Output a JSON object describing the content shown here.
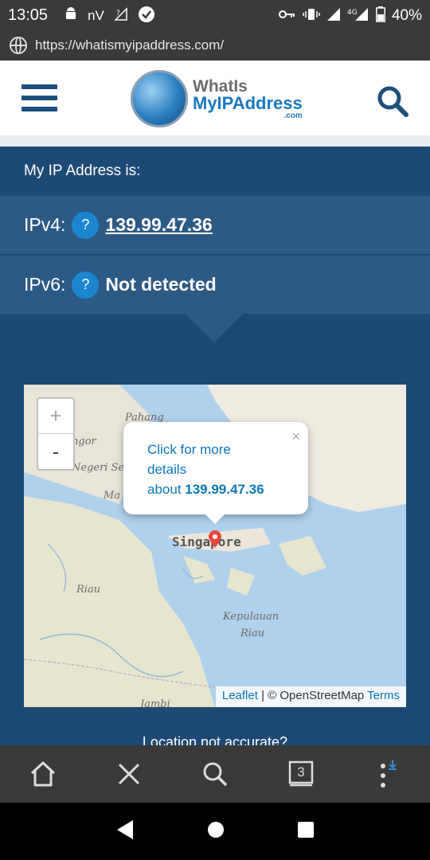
{
  "status_bar": {
    "time": "13:05",
    "carrier": "nV",
    "battery": "40%"
  },
  "url_bar": {
    "url": "https://whatismyipaddress.com/"
  },
  "header": {
    "logo_line1": "WhatIs",
    "logo_line2": "MyIPAddress",
    "logo_line3": ".com"
  },
  "main": {
    "my_ip_label": "My IP Address is:",
    "ipv4_label": "IPv4:",
    "ipv4_value": "139.99.47.36",
    "ipv6_label": "IPv6:",
    "ipv6_value": "Not detected",
    "help_badge": "?",
    "location_text": "Location not accurate?"
  },
  "map": {
    "zoom_in": "+",
    "zoom_out": "-",
    "popup_line1": "Click for more",
    "popup_line2": "details",
    "popup_line3_prefix": "about ",
    "popup_ip": "139.99.47.36",
    "popup_close": "×",
    "labels": {
      "pahang": "Pahang",
      "ngor": "ngor",
      "negeri": "Negeri Sem",
      "ma": "Ma",
      "singapore": "Singapore",
      "riau": "Riau",
      "kepulauan": "Kepulauan",
      "riau2": "Riau",
      "jambi": "Jambi"
    },
    "attribution_leaflet": "Leaflet",
    "attribution_sep": " | © OpenStreetMap ",
    "attribution_terms": "Terms"
  },
  "toolbar": {
    "tab_count": "3"
  }
}
